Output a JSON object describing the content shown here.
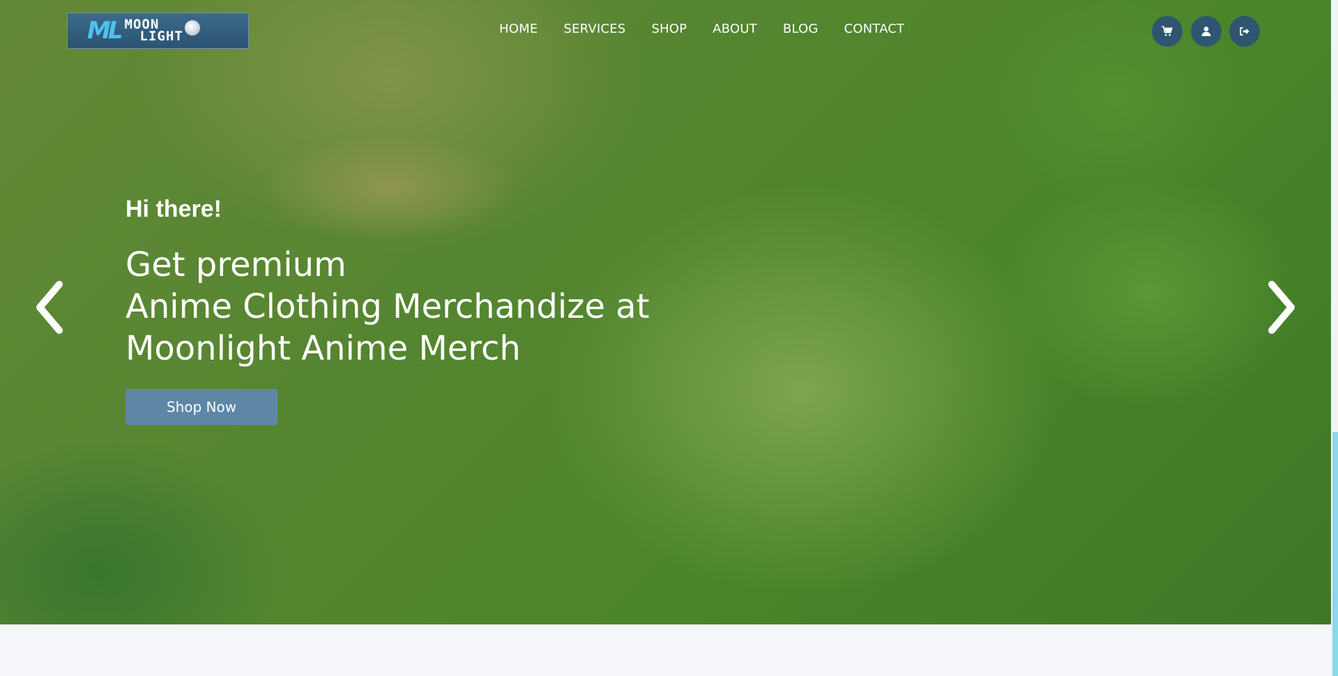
{
  "header": {
    "logo": {
      "mark": "ML",
      "line1": "MOON",
      "line2": "LIGHT"
    },
    "nav": [
      "HOME",
      "SERVICES",
      "SHOP",
      "ABOUT",
      "BLOG",
      "CONTACT"
    ],
    "icons": [
      "cart-icon",
      "user-icon",
      "sign-out-icon"
    ]
  },
  "hero": {
    "greeting": "Hi there!",
    "title_lines": [
      "Get premium",
      "Anime Clothing Merchandize at",
      "Moonlight Anime Merch"
    ],
    "cta_label": "Shop Now",
    "prev_icon": "chevron-left-icon",
    "next_icon": "chevron-right-icon"
  },
  "colors": {
    "hero_tint": "#5e8a36",
    "nav_icon_bg": "#2e5670",
    "cta_bg": "#5e87a6",
    "page_bg": "#f4f6fa",
    "scrollbar_thumb": "#8ad9e8"
  }
}
